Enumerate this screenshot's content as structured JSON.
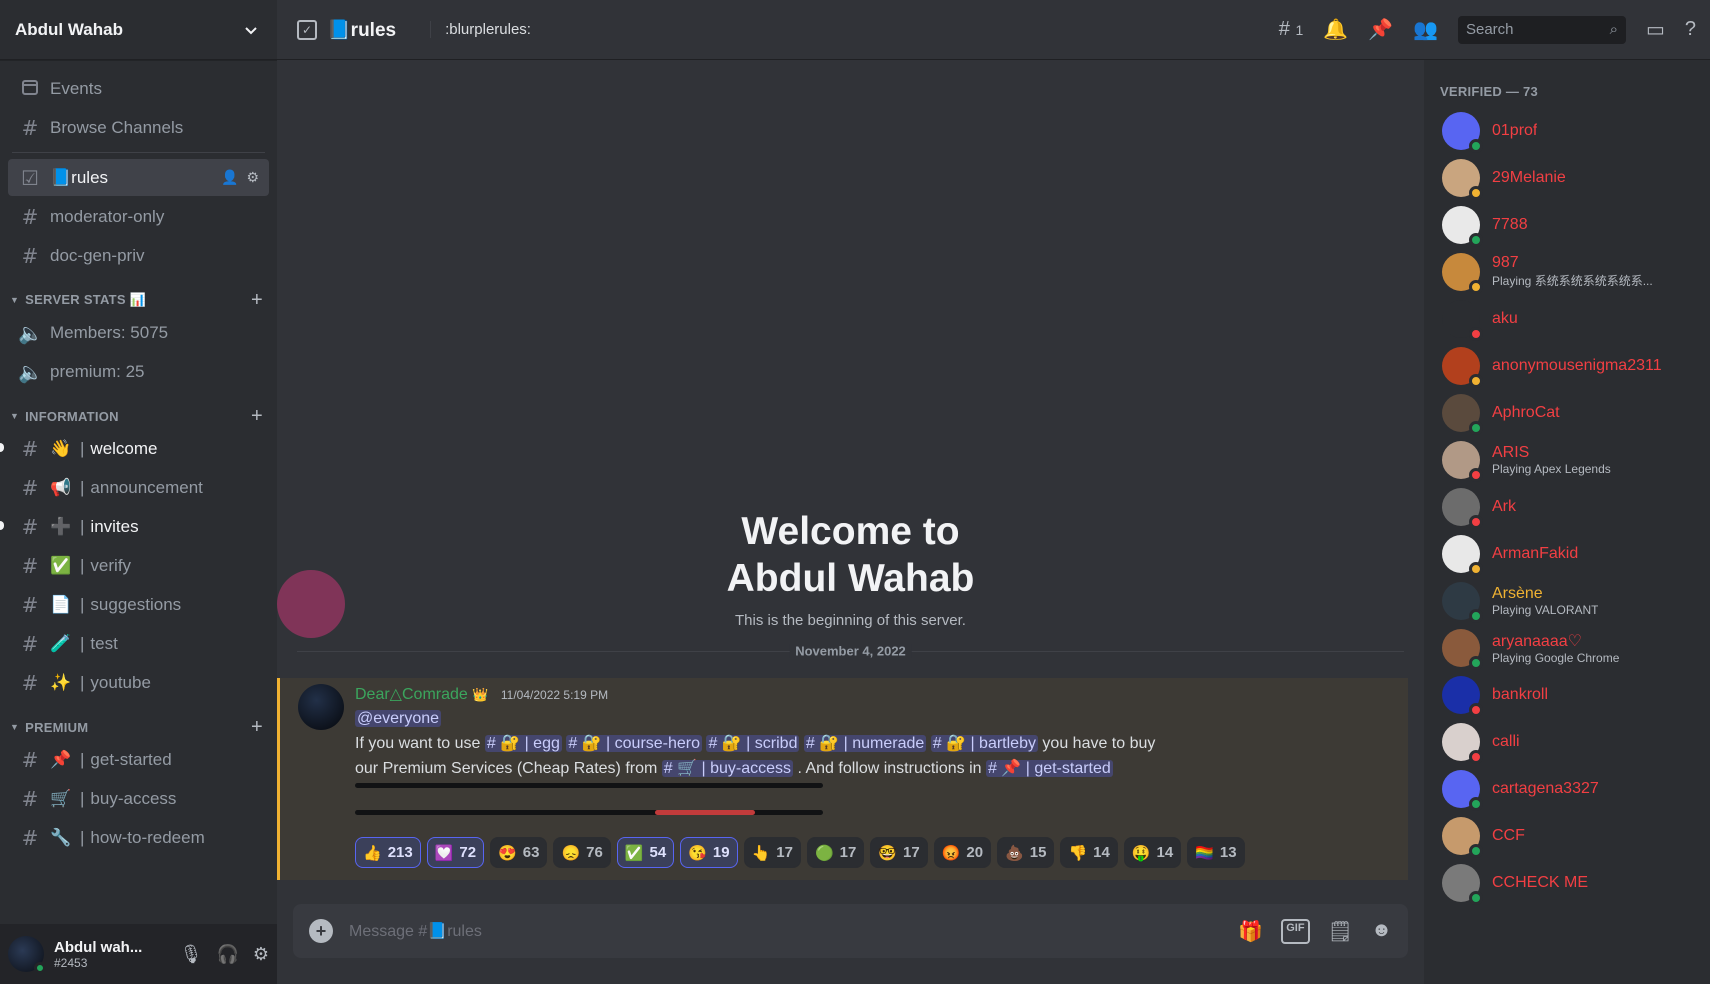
{
  "server": {
    "name": "Abdul Wahab"
  },
  "sidebar": {
    "top": [
      {
        "label": "Events",
        "icon": "calendar-icon"
      },
      {
        "label": "Browse Channels",
        "icon": "browse-channels-icon"
      }
    ],
    "pinned": [
      {
        "label": "rules",
        "emoji": "📘",
        "active": true
      },
      {
        "label": "moderator-only"
      },
      {
        "label": "doc-gen-priv"
      }
    ],
    "categories": [
      {
        "name": "SERVER STATS 📊",
        "items": [
          {
            "label": "Members: 5075",
            "voice": true
          },
          {
            "label": "premium: 25",
            "voice": true
          }
        ]
      },
      {
        "name": "INFORMATION",
        "items": [
          {
            "label": "welcome",
            "emoji": "👋",
            "bright": true
          },
          {
            "label": "announcement",
            "emoji": "📢"
          },
          {
            "label": "invites",
            "emoji": "➕",
            "bright": true
          },
          {
            "label": "verify",
            "emoji": "✅"
          },
          {
            "label": "suggestions",
            "emoji": "📄"
          },
          {
            "label": "test",
            "emoji": "🧪"
          },
          {
            "label": "youtube",
            "emoji": "✨"
          }
        ]
      },
      {
        "name": "PREMIUM",
        "items": [
          {
            "label": "get-started",
            "emoji": "📌"
          },
          {
            "label": "buy-access",
            "emoji": "🛒"
          },
          {
            "label": "how-to-redeem",
            "emoji": "🔧"
          }
        ]
      }
    ]
  },
  "user": {
    "name": "Abdul wah...",
    "tag": "#2453"
  },
  "topbar": {
    "channel": "rules",
    "topic": ":blurplerules:",
    "threads_count": "1",
    "search_placeholder": "Search"
  },
  "welcome": {
    "title_line1": "Welcome to",
    "title_line2": "Abdul Wahab",
    "subtitle": "This is the beginning of this server."
  },
  "date_divider": "November 4, 2022",
  "message": {
    "author": "Dear△Comrade",
    "timestamp": "11/04/2022 5:19 PM",
    "mention": "@everyone",
    "text_1": "If you want to use",
    "ch_egg": "# 🔐 | egg",
    "ch_course": "# 🔐 | course-hero",
    "ch_scribd": "# 🔐 | scribd",
    "ch_numerade": "# 🔐 | numerade",
    "ch_bartleby": "# 🔐 | bartleby",
    "text_2": "you have to buy",
    "text_3": "our Premium Services (Cheap Rates) from",
    "ch_buy": "# 🛒 | buy-access",
    "text_4": ". And follow instructions in",
    "ch_get": "# 📌 | get-started",
    "reactions": [
      {
        "emoji": "👍",
        "count": "213",
        "on": true
      },
      {
        "emoji": "💟",
        "count": "72",
        "on": true
      },
      {
        "emoji": "😍",
        "count": "63"
      },
      {
        "emoji": "😞",
        "count": "76"
      },
      {
        "emoji": "✅",
        "count": "54",
        "on": true
      },
      {
        "emoji": "😘",
        "count": "19",
        "on": true
      },
      {
        "emoji": "👆",
        "count": "17"
      },
      {
        "emoji": "🟢",
        "count": "17"
      },
      {
        "emoji": "🤓",
        "count": "17"
      },
      {
        "emoji": "😡",
        "count": "20"
      },
      {
        "emoji": "💩",
        "count": "15"
      },
      {
        "emoji": "👎",
        "count": "14"
      },
      {
        "emoji": "🤑",
        "count": "14"
      },
      {
        "emoji": "🏳️‍🌈",
        "count": "13"
      }
    ]
  },
  "composer": {
    "placeholder": "Message #📘rules"
  },
  "members": {
    "header": "VERIFIED — 73",
    "list": [
      {
        "name": "01prof",
        "status": "online",
        "color": "#5865f2"
      },
      {
        "name": "29Melanie",
        "status": "idle",
        "color": "#c9a57f"
      },
      {
        "name": "7788",
        "status": "online",
        "color": "#e9e9e9"
      },
      {
        "name": "987",
        "status": "idle",
        "activity": "Playing 系统系统系统系统系...",
        "color": "#c7893c"
      },
      {
        "name": "aku",
        "status": "dnd",
        "color": "#2b2d31"
      },
      {
        "name": "anonymousenigma2311",
        "status": "idle",
        "color": "#b2401d"
      },
      {
        "name": "AphroCat",
        "status": "online",
        "color": "#5a4a3d"
      },
      {
        "name": "ARIS",
        "status": "dnd",
        "activity": "Playing Apex Legends",
        "color": "#b19986"
      },
      {
        "name": "Ark",
        "status": "dnd",
        "color": "#6c6c6c"
      },
      {
        "name": "ArmanFakid",
        "status": "idle",
        "color": "#e8e8e8"
      },
      {
        "name": "Arsène",
        "status": "online",
        "activity": "Playing VALORANT",
        "gold": true,
        "color": "#2e3a44"
      },
      {
        "name": "aryanaaaa♡",
        "status": "online",
        "activity": "Playing Google Chrome",
        "color": "#8a5a3c"
      },
      {
        "name": "bankroll",
        "status": "dnd",
        "color": "#1a2fa8"
      },
      {
        "name": "calli",
        "status": "dnd",
        "color": "#d9d0cd"
      },
      {
        "name": "cartagena3327",
        "status": "online",
        "color": "#5865f2"
      },
      {
        "name": "CCF",
        "status": "online",
        "color": "#c69a6c"
      },
      {
        "name": "CCHECK ME",
        "status": "online",
        "color": "#7a7a7a"
      }
    ]
  },
  "colors": {
    "online": "#23a55a",
    "idle": "#f0b232",
    "dnd": "#f23f43"
  }
}
